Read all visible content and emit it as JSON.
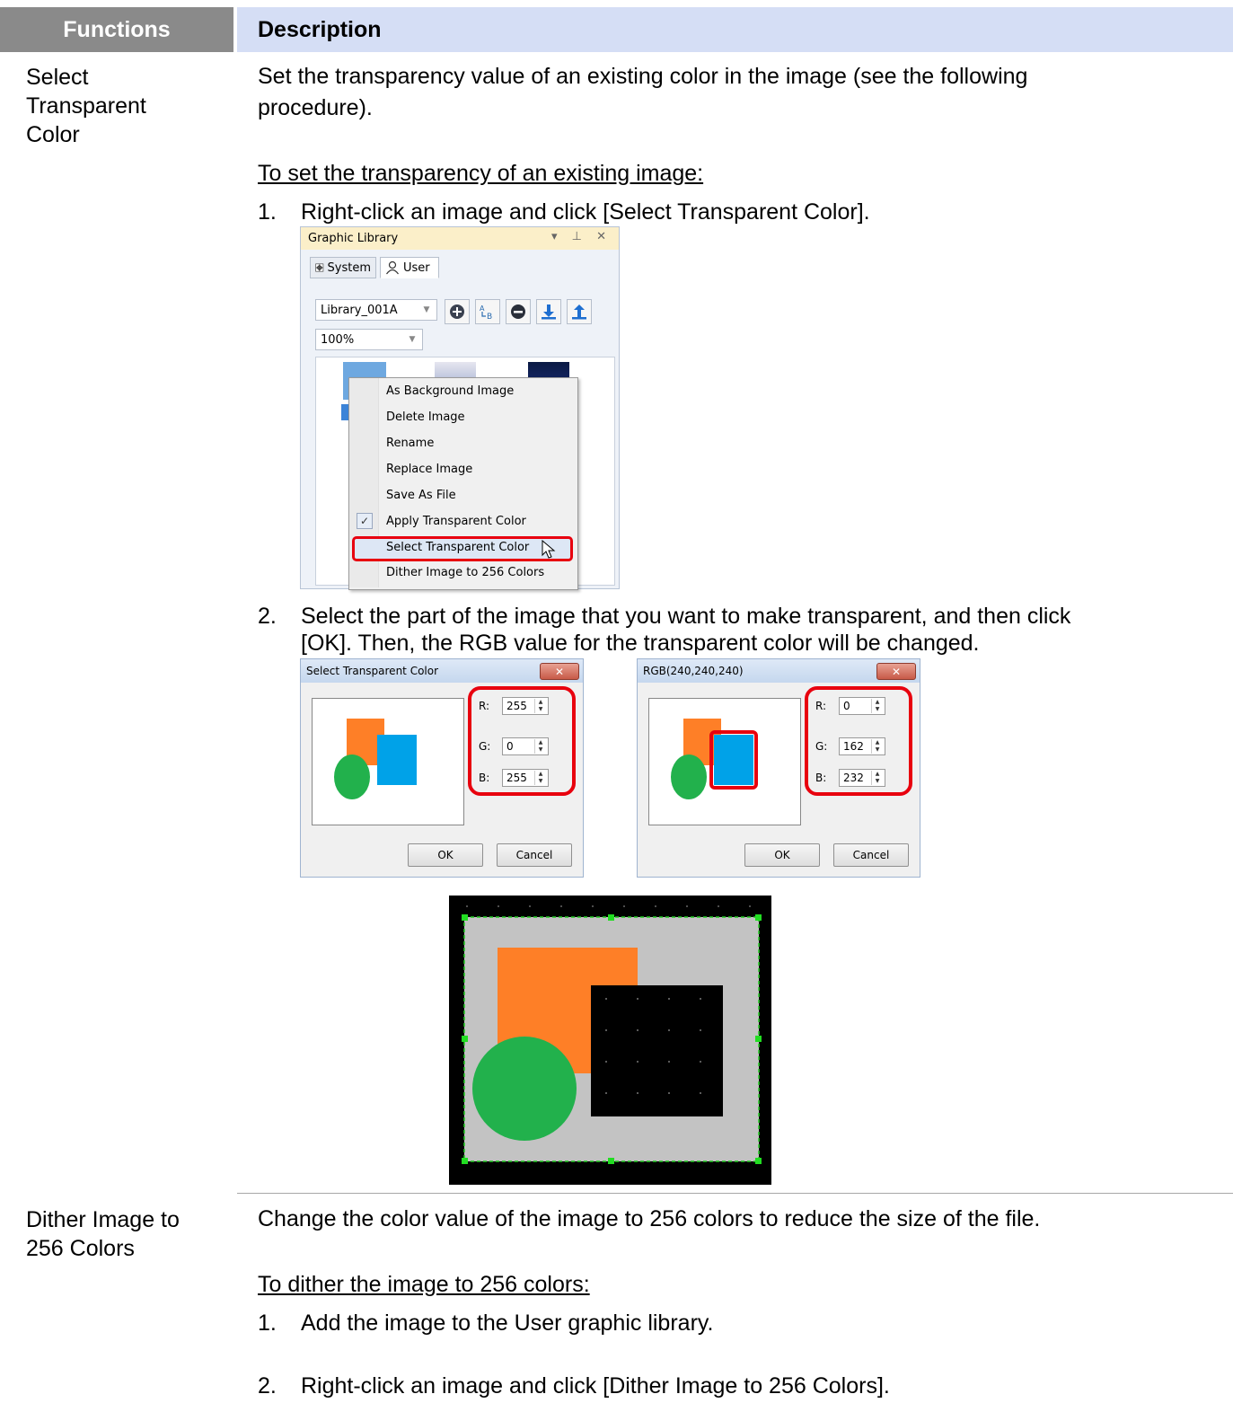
{
  "table": {
    "header_functions": "Functions",
    "header_description": "Description"
  },
  "row1": {
    "function_lines": [
      "Select",
      "Transparent",
      "Color"
    ],
    "description_lines": [
      "Set the transparency value of an existing color in the image (see the following",
      "procedure)."
    ],
    "procedure_title": "To set the transparency of an existing image:",
    "step1_num": "1.",
    "step1_text": "Right-click an image and click [Select Transparent Color].",
    "step2_num": "2.",
    "step2_line1": "Select the part of the image that you want to make transparent, and then click",
    "step2_line2": "[OK]. Then, the RGB value for the transparent color will be changed."
  },
  "graphic_library": {
    "title": "Graphic Library",
    "title_controls": "▾ ⊥ ✕",
    "tab_system": "System",
    "tab_user": "User",
    "library_value": "Library_001A",
    "zoom_value": "100%",
    "toolbar_icons": [
      "add-icon",
      "rename-icon",
      "remove-icon",
      "import-icon",
      "export-icon"
    ]
  },
  "context_menu": {
    "items": [
      "As Background Image",
      "Delete Image",
      "Rename",
      "Replace Image",
      "Save As File",
      "Apply Transparent Color",
      "Select Transparent Color",
      "Dither Image to 256 Colors"
    ],
    "checked_item": "Apply Transparent Color",
    "highlighted_item": "Select Transparent Color"
  },
  "dialog1": {
    "title": "Select Transparent Color",
    "close": "✕",
    "r_label": "R:",
    "r_value": "255",
    "g_label": "G:",
    "g_value": "0",
    "b_label": "B:",
    "b_value": "255",
    "ok": "OK",
    "cancel": "Cancel"
  },
  "dialog2": {
    "title": "RGB(240,240,240)",
    "close": "✕",
    "r_label": "R:",
    "r_value": "0",
    "g_label": "G:",
    "g_value": "162",
    "b_label": "B:",
    "b_value": "232",
    "ok": "OK",
    "cancel": "Cancel"
  },
  "colors": {
    "orange": "#fe7f27",
    "blue": "#00a2e8",
    "green": "#22b14c",
    "highlight_red": "#e8000e",
    "header_gray": "#8a8a8a",
    "header_blue": "#d5def5"
  },
  "row2": {
    "function_lines": [
      "Dither Image to",
      "256 Colors"
    ],
    "description": "Change the color value of the image to 256 colors to reduce the size of the file.",
    "procedure_title": "To dither the image to 256 colors:",
    "step1_num": "1.",
    "step1_text": "Add the image to the User graphic library.",
    "step2_num": "2.",
    "step2_text": "Right-click an image and click [Dither Image to 256 Colors]."
  }
}
